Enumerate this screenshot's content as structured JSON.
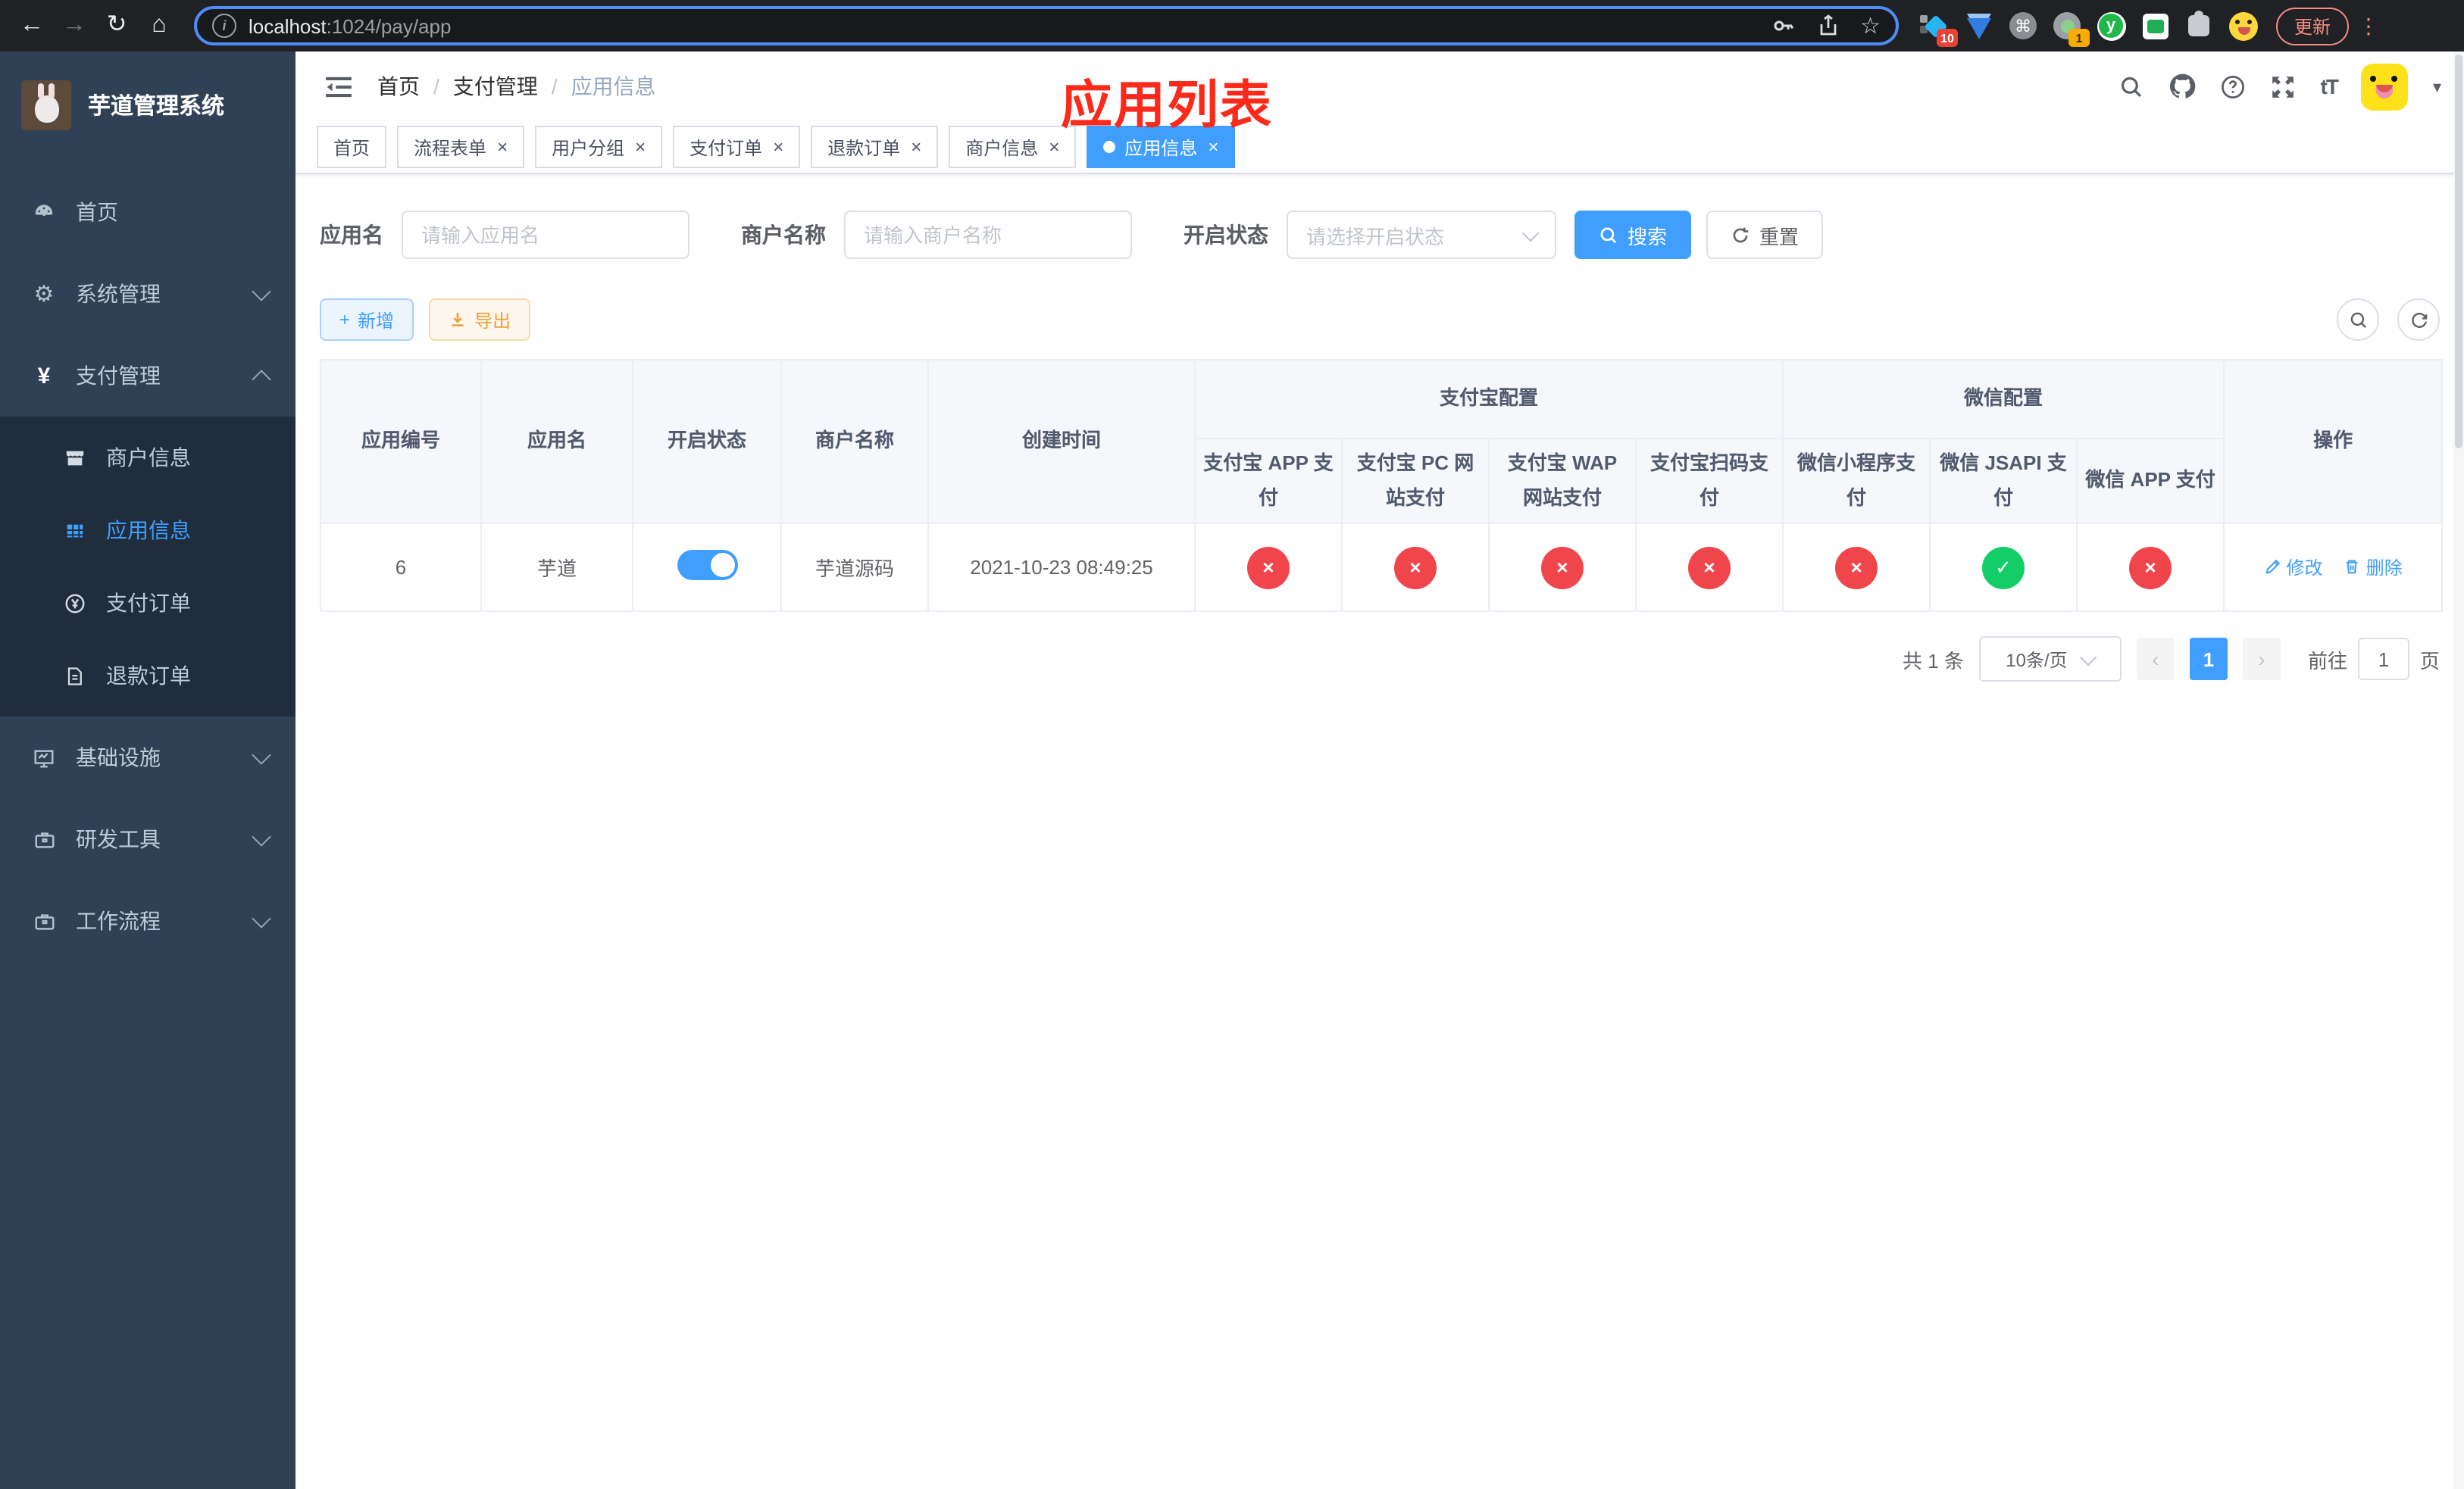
{
  "colors": {
    "accent": "#409eff",
    "danger": "#f0464b",
    "success": "#13ce66",
    "annotation_red": "#fb2a1a",
    "sidebar_bg": "#304156",
    "submenu_bg": "#1f2d3d"
  },
  "icons": {
    "back": "←",
    "forward": "→",
    "reload": "↻",
    "home": "⌂",
    "star": "☆",
    "command": "⌘",
    "kebab": "⋮",
    "caret_down": "▾",
    "close": "×",
    "gear": "⚙",
    "yen": "¥",
    "plus": "+",
    "font_size": "tT",
    "prev": "‹",
    "next": "›",
    "check": "✓",
    "cross": "×",
    "info": "i",
    "ext_y": "y"
  },
  "browser": {
    "url_host": "localhost",
    "url_rest": ":1024/pay/app",
    "extension_badge_10": "10",
    "extension_badge_1": "1",
    "update_label": "更新"
  },
  "sidebar": {
    "title": "芋道管理系统",
    "items": [
      {
        "label": "首页",
        "icon": "dashboard-icon"
      },
      {
        "label": "系统管理",
        "icon": "gear-icon",
        "expanded": false
      },
      {
        "label": "支付管理",
        "icon": "yen-icon",
        "expanded": true
      },
      {
        "label": "商户信息",
        "icon": "shop-icon"
      },
      {
        "label": "应用信息",
        "icon": "grid-icon",
        "active": true
      },
      {
        "label": "支付订单",
        "icon": "yen-circle-icon"
      },
      {
        "label": "退款订单",
        "icon": "document-icon"
      },
      {
        "label": "基础设施",
        "icon": "monitor-icon",
        "expanded": false
      },
      {
        "label": "研发工具",
        "icon": "briefcase-icon",
        "expanded": false
      },
      {
        "label": "工作流程",
        "icon": "briefcase-icon",
        "expanded": false
      }
    ]
  },
  "header": {
    "breadcrumb": [
      "首页",
      "支付管理",
      "应用信息"
    ]
  },
  "annotation": {
    "text": "应用列表"
  },
  "tabs": [
    {
      "label": "首页",
      "closable": false,
      "active": false
    },
    {
      "label": "流程表单",
      "closable": true,
      "active": false
    },
    {
      "label": "用户分组",
      "closable": true,
      "active": false
    },
    {
      "label": "支付订单",
      "closable": true,
      "active": false
    },
    {
      "label": "退款订单",
      "closable": true,
      "active": false
    },
    {
      "label": "商户信息",
      "closable": true,
      "active": false
    },
    {
      "label": "应用信息",
      "closable": true,
      "active": true
    }
  ],
  "search": {
    "app_name_label": "应用名",
    "app_name_placeholder": "请输入应用名",
    "merchant_label": "商户名称",
    "merchant_placeholder": "请输入商户名称",
    "status_label": "开启状态",
    "status_placeholder": "请选择开启状态",
    "search_button": "搜索",
    "reset_button": "重置"
  },
  "toolbar": {
    "add_button": "新增",
    "export_button": "导出"
  },
  "table": {
    "group_headers": {
      "alipay": "支付宝配置",
      "wechat": "微信配置"
    },
    "columns": {
      "app_id": "应用编号",
      "app_name": "应用名",
      "status": "开启状态",
      "merchant_name": "商户名称",
      "create_time": "创建时间",
      "operation": "操作"
    },
    "payment_columns": [
      "支付宝 APP 支付",
      "支付宝 PC 网站支付",
      "支付宝 WAP 网站支付",
      "支付宝扫码支付",
      "微信小程序支付",
      "微信 JSAPI 支付",
      "微信 APP 支付"
    ],
    "rows": [
      {
        "app_id": "6",
        "app_name": "芋道",
        "enabled": true,
        "merchant_name": "芋道源码",
        "create_time": "2021-10-23 08:49:25",
        "payments": [
          "cross",
          "cross",
          "cross",
          "cross",
          "cross",
          "check",
          "cross"
        ],
        "edit_label": "修改",
        "delete_label": "删除"
      }
    ]
  },
  "pagination": {
    "total_label": "共 1 条",
    "page_size_label": "10条/页",
    "page": "1",
    "goto_label": "前往",
    "goto_value": "1",
    "unit_label": "页"
  }
}
